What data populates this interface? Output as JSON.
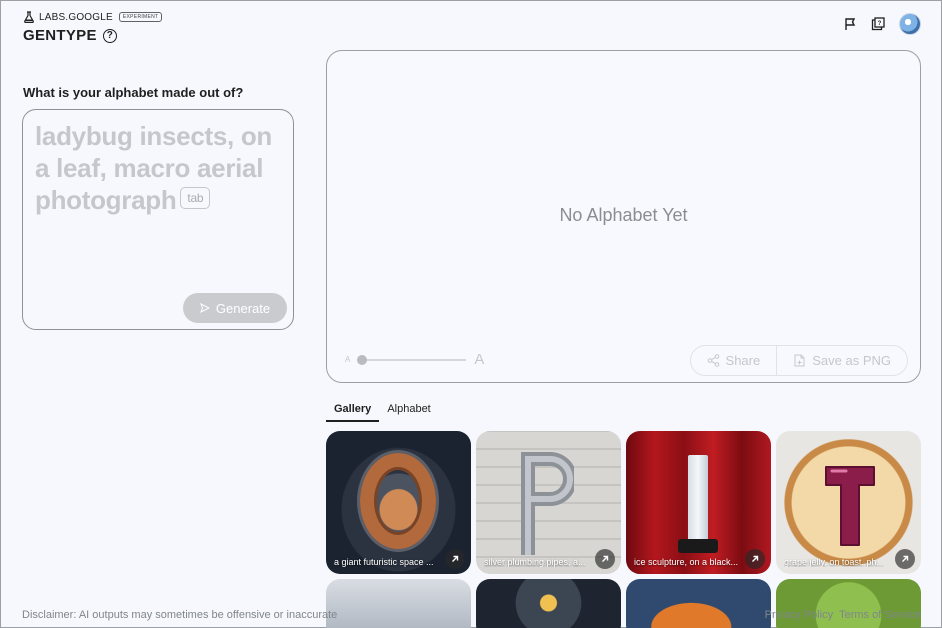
{
  "header": {
    "brand": "LABS.GOOGLE",
    "badge": "EXPERIMENT",
    "title": "GENTYPE",
    "help_glyph": "?",
    "icons": [
      "flask-icon",
      "help-icon",
      "flag-icon",
      "feedback-icon",
      "avatar"
    ]
  },
  "prompt": {
    "label": "What is your alphabet made out of?",
    "placeholder": "ladybug insects, on a leaf, macro aerial photograph",
    "tab_hint": "tab",
    "generate_label": "Generate"
  },
  "canvas": {
    "empty_message": "No Alphabet Yet",
    "size_small": "A",
    "size_large": "A",
    "size_level": 0,
    "share_label": "Share",
    "save_label": "Save as PNG"
  },
  "tabs": [
    {
      "label": "Gallery",
      "active": true
    },
    {
      "label": "Alphabet",
      "active": false
    }
  ],
  "gallery": [
    {
      "caption": "a giant futuristic space ..."
    },
    {
      "caption": "silver plumbing pipes, a..."
    },
    {
      "caption": "ice sculpture, on a black..."
    },
    {
      "caption": "grape jelly, on toast, ph..."
    }
  ],
  "footer": {
    "disclaimer": "Disclaimer: AI outputs may sometimes be offensive or inaccurate",
    "privacy": "Privacy Policy",
    "terms": "Terms of Service"
  },
  "colors": {
    "background": "#f6f8fd",
    "disabled_button": "#c9cbcf",
    "text": "#1f1f1f"
  }
}
